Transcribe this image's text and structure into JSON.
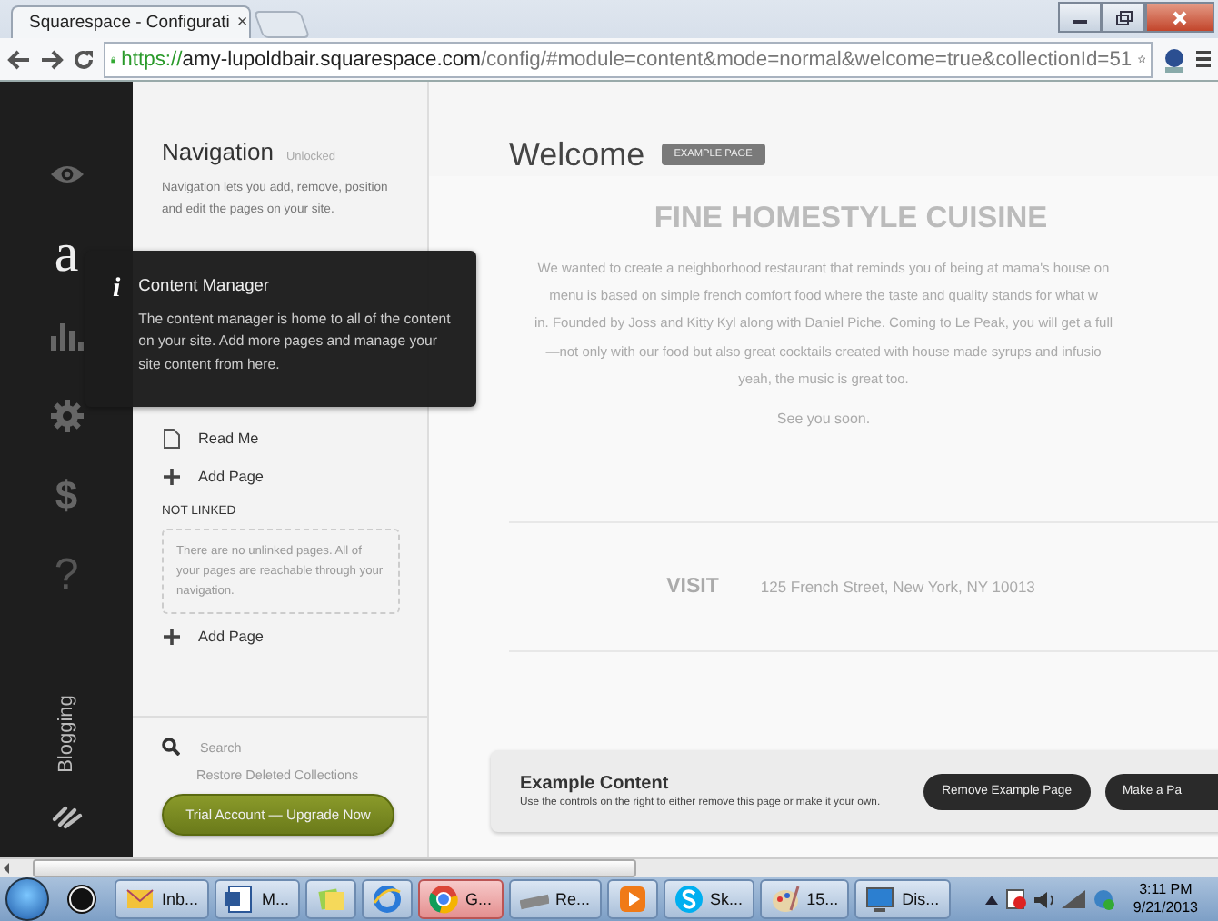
{
  "browser": {
    "tab": {
      "title": "Squarespace - Configurati",
      "close": "×"
    },
    "url": {
      "scheme": "https://",
      "host": "amy-lupoldbair.squarespace.com",
      "path": "/config/#module=content&mode=normal&welcome=true&collectionId=51"
    }
  },
  "rail": {
    "logo_letter": "a",
    "dollar": "$",
    "help": "?",
    "section_label": "Blogging"
  },
  "nav": {
    "title": "Navigation",
    "status": "Unlocked",
    "description": "Navigation lets you add, remove, position and edit the pages on your site.",
    "items": [
      {
        "kind": "page",
        "label": "Read Me"
      },
      {
        "kind": "add",
        "label": "Add Page"
      }
    ],
    "not_linked_heading": "NOT LINKED",
    "empty_note": "There are no unlinked pages. All of your pages are reachable through your navigation.",
    "not_linked_items": [
      {
        "kind": "add",
        "label": "Add Page"
      }
    ],
    "search": "Search",
    "restore": "Restore Deleted Collections",
    "upgrade_button": "Trial Account — Upgrade Now"
  },
  "tooltip": {
    "icon": "i",
    "title": "Content Manager",
    "text": "The content manager is home to all of the content on your site. Add more pages and manage your site content from here."
  },
  "main": {
    "title": "Welcome",
    "badge": "EXAMPLE PAGE",
    "heading": "FINE HOMESTYLE CUISINE",
    "lines": [
      "We wanted to create a neighborhood restaurant that reminds you of being at mama's house on",
      "menu is based on simple french comfort food where the taste and quality stands for what w",
      "in. Founded by Joss and Kitty Kyl along with Daniel Piche. Coming to Le Peak, you will get a full",
      "—not only with our food but also great cocktails created with house made syrups and infusio",
      "yeah, the music is great too."
    ],
    "closing": "See you soon.",
    "visit_label": "VISIT",
    "address": "125 French Street, New York, NY 10013",
    "notice": {
      "title": "Example Content",
      "text": "Use the controls on the right to either remove this page or make it your own.",
      "buttons": [
        "Remove Example Page",
        "Make a Pa"
      ]
    }
  },
  "taskbar": {
    "items": [
      {
        "kind": "hp",
        "selected": false
      },
      {
        "kind": "mail",
        "label": "Inb...",
        "selected": false
      },
      {
        "kind": "word",
        "label": "M...",
        "selected": false
      },
      {
        "kind": "folders",
        "selected": false
      },
      {
        "kind": "ie",
        "selected": false
      },
      {
        "kind": "chrome",
        "label": "G...",
        "selected": true
      },
      {
        "kind": "drive",
        "label": "Re...",
        "selected": false
      },
      {
        "kind": "media",
        "selected": false
      },
      {
        "kind": "skype",
        "label": "Sk...",
        "selected": false
      },
      {
        "kind": "paint",
        "label": "15...",
        "selected": false
      },
      {
        "kind": "display",
        "label": "Dis...",
        "selected": false
      }
    ],
    "time": "3:11 PM",
    "date": "9/21/2013"
  }
}
